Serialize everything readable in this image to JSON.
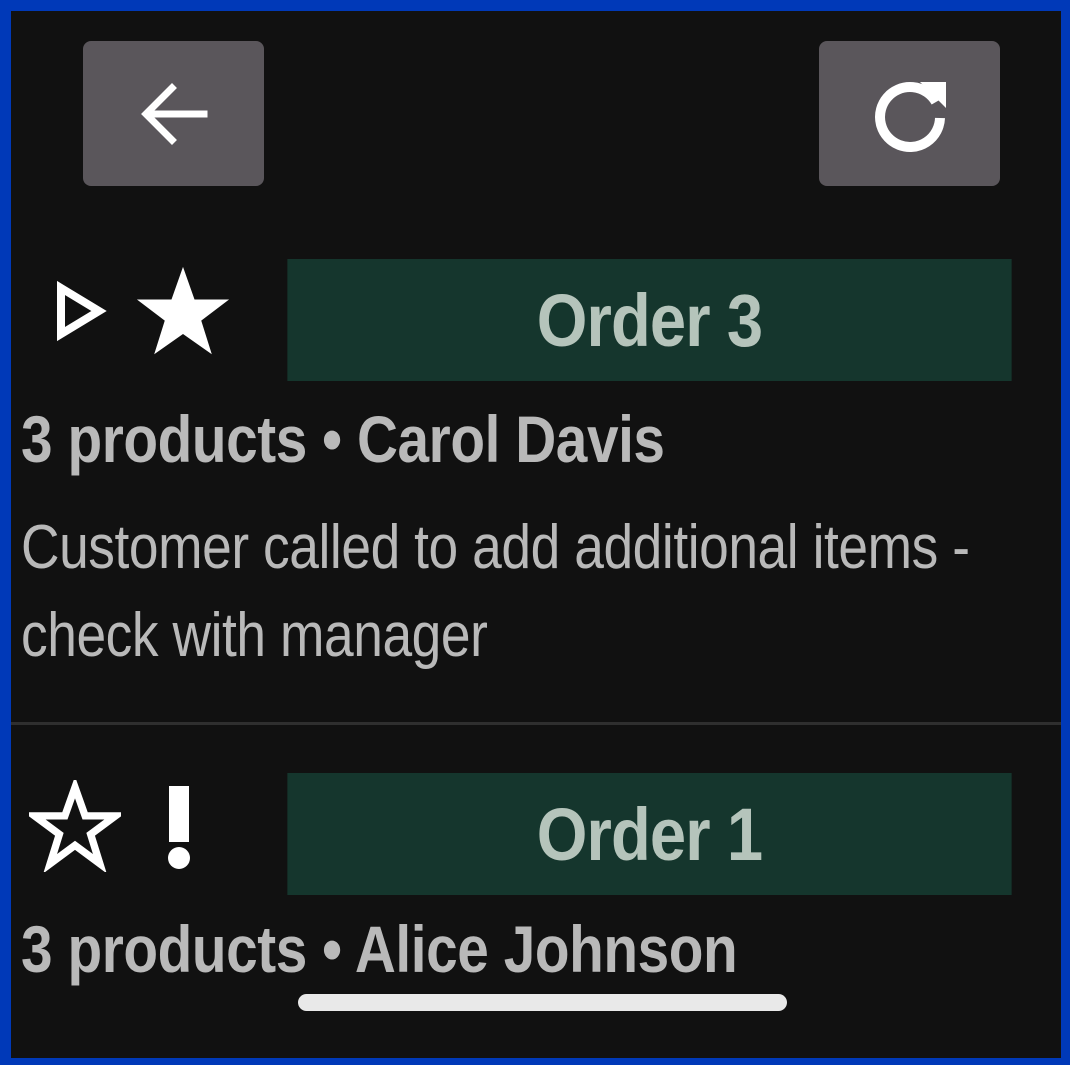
{
  "toolbar": {
    "back_icon": "arrow-left-icon",
    "refresh_icon": "refresh-icon"
  },
  "orders": [
    {
      "title": "Order 3",
      "summary": "3 products • Carol Davis",
      "note": "Customer called to add additional items - check with manager",
      "icons": [
        "play-outline-icon",
        "star-filled-icon"
      ]
    },
    {
      "title": "Order 1",
      "summary": "3 products • Alice Johnson",
      "icons": [
        "star-outline-icon",
        "exclamation-icon"
      ]
    }
  ],
  "colors": {
    "frame_border": "#0039b8",
    "background": "#111111",
    "button": "#5a565b",
    "banner": "#15362d",
    "banner_text": "#b5c4bb",
    "text": "#b9b9b9"
  }
}
